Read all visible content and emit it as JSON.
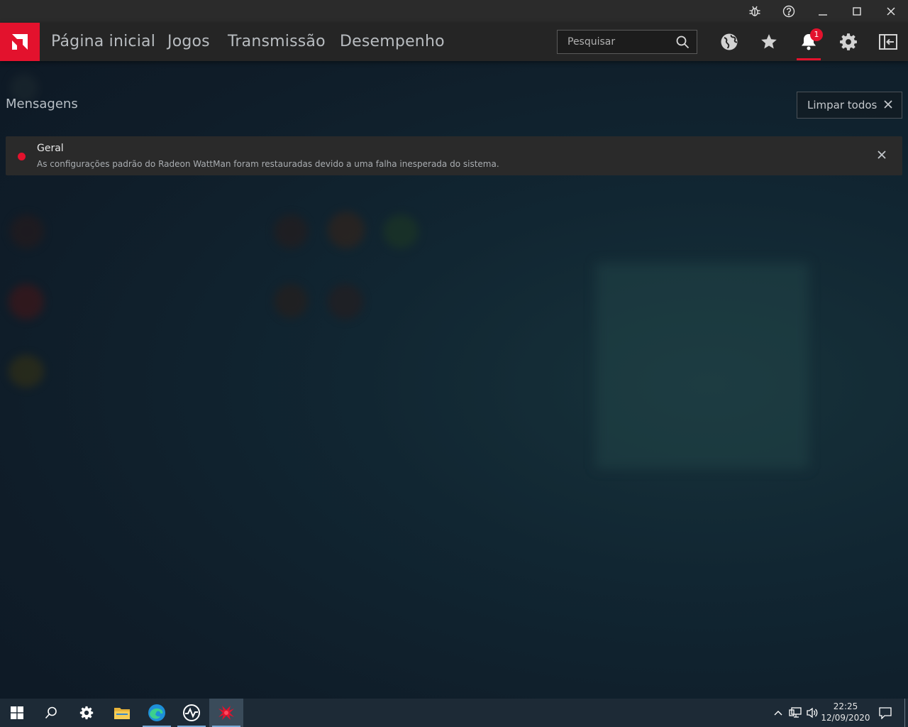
{
  "colors": {
    "accent": "#e3122d",
    "navbar": "#252525",
    "card": "#2a2a2a"
  },
  "nav": {
    "items": [
      {
        "label": "Página inicial"
      },
      {
        "label": "Jogos"
      },
      {
        "label": "Transmissão"
      },
      {
        "label": "Desempenho"
      }
    ],
    "search_placeholder": "Pesquisar",
    "notification_count": "1"
  },
  "messages": {
    "title": "Mensagens",
    "clear_all_label": "Limpar todos",
    "items": [
      {
        "title": "Geral",
        "body": "As configurações padrão do Radeon WattMan foram restauradas devido a uma falha inesperada do sistema."
      }
    ]
  },
  "taskbar": {
    "time": "22:25",
    "date": "12/09/2020"
  }
}
